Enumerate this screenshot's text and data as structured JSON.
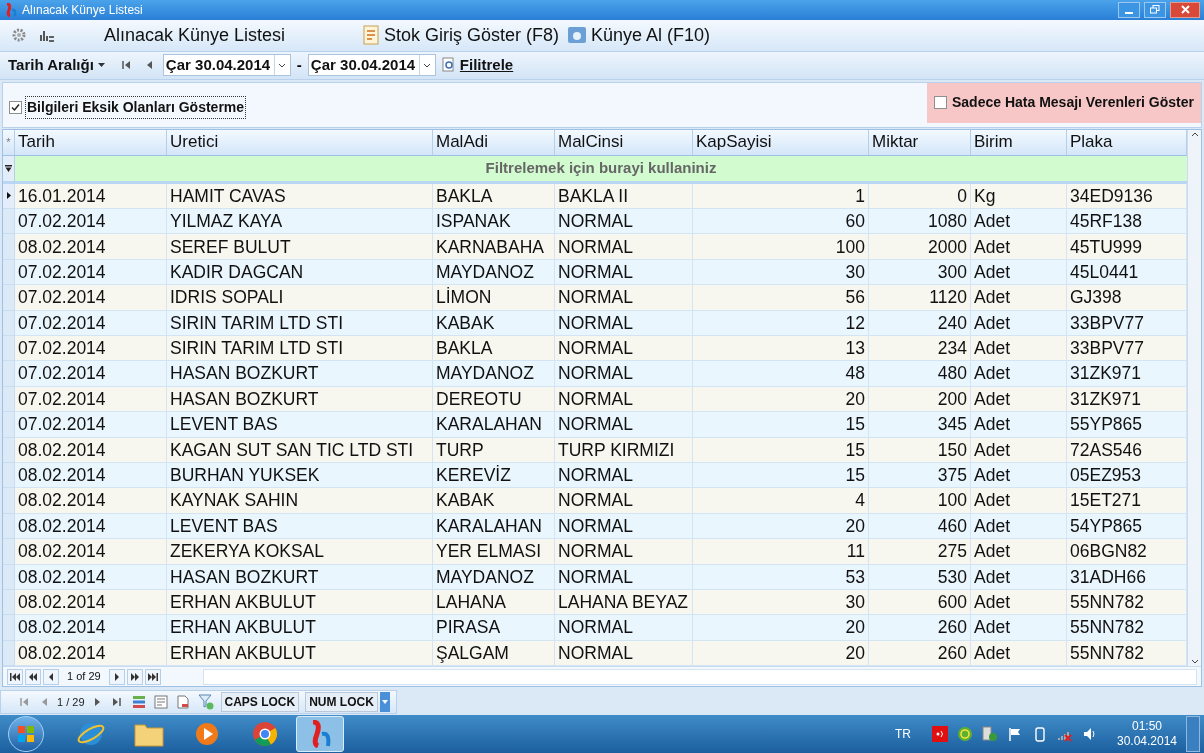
{
  "window": {
    "title": "Alınacak Künye Listesi"
  },
  "toolbar": {
    "title": "Alınacak Künye Listesi",
    "buttons": [
      "Stok Giriş Göster (F8)",
      "Künye Al (F10)"
    ]
  },
  "filter_bar": {
    "range_label": "Tarih Aralığı",
    "start_date": "Çar 30.04.2014",
    "separator": "-",
    "end_date": "Çar 30.04.2014",
    "filter_button": "Filitrele"
  },
  "options": [
    {
      "label": "Bilgileri Eksik Olanları Gösterme",
      "checked": true
    },
    {
      "label": "Sadece Hata Mesajı Verenleri Göster",
      "checked": false
    }
  ],
  "table": {
    "header_marker": "*",
    "columns": [
      "Tarih",
      "Uretici",
      "MalAdi",
      "MalCinsi",
      "KapSayisi",
      "Miktar",
      "Birim",
      "Plaka"
    ],
    "filter_hint": "Filtrelemek için burayi kullaniniz",
    "rows": [
      {
        "selected": true,
        "cells": [
          "16.01.2014",
          "HAMIT CAVAS",
          "BAKLA",
          "BAKLA II",
          "1",
          "0",
          "Kg",
          "34ED9136"
        ]
      },
      {
        "selected": false,
        "cells": [
          "07.02.2014",
          "YILMAZ KAYA",
          "ISPANAK",
          "NORMAL",
          "60",
          "1080",
          "Adet",
          "45RF138"
        ]
      },
      {
        "selected": false,
        "cells": [
          "08.02.2014",
          "SEREF BULUT",
          "KARNABAHA",
          "NORMAL",
          "100",
          "2000",
          "Adet",
          "45TU999"
        ]
      },
      {
        "selected": false,
        "cells": [
          "07.02.2014",
          "KADIR DAGCAN",
          "MAYDANOZ",
          "NORMAL",
          "30",
          "300",
          "Adet",
          "45L0441"
        ]
      },
      {
        "selected": false,
        "cells": [
          "07.02.2014",
          "IDRIS SOPALI",
          "LİMON",
          "NORMAL",
          "56",
          "1120",
          "Adet",
          "GJ398"
        ]
      },
      {
        "selected": false,
        "cells": [
          "07.02.2014",
          "SIRIN TARIM LTD STI",
          "KABAK",
          "NORMAL",
          "12",
          "240",
          "Adet",
          "33BPV77"
        ]
      },
      {
        "selected": false,
        "cells": [
          "07.02.2014",
          "SIRIN TARIM LTD STI",
          "BAKLA",
          "NORMAL",
          "13",
          "234",
          "Adet",
          "33BPV77"
        ]
      },
      {
        "selected": false,
        "cells": [
          "07.02.2014",
          "HASAN BOZKURT",
          "MAYDANOZ",
          "NORMAL",
          "48",
          "480",
          "Adet",
          "31ZK971"
        ]
      },
      {
        "selected": false,
        "cells": [
          "07.02.2014",
          "HASAN BOZKURT",
          "DEREOTU",
          "NORMAL",
          "20",
          "200",
          "Adet",
          "31ZK971"
        ]
      },
      {
        "selected": false,
        "cells": [
          "07.02.2014",
          "LEVENT BAS",
          "KARALAHAN",
          "NORMAL",
          "15",
          "345",
          "Adet",
          "55YP865"
        ]
      },
      {
        "selected": false,
        "cells": [
          "08.02.2014",
          "KAGAN SUT SAN TIC LTD STI",
          "TURP",
          "TURP KIRMIZI",
          "15",
          "150",
          "Adet",
          "72AS546"
        ]
      },
      {
        "selected": false,
        "cells": [
          "08.02.2014",
          "BURHAN YUKSEK",
          "KEREVİZ",
          "NORMAL",
          "15",
          "375",
          "Adet",
          "05EZ953"
        ]
      },
      {
        "selected": false,
        "cells": [
          "08.02.2014",
          "KAYNAK SAHIN",
          "KABAK",
          "NORMAL",
          "4",
          "100",
          "Adet",
          "15ET271"
        ]
      },
      {
        "selected": false,
        "cells": [
          "08.02.2014",
          "LEVENT BAS",
          "KARALAHAN",
          "NORMAL",
          "20",
          "460",
          "Adet",
          "54YP865"
        ]
      },
      {
        "selected": false,
        "cells": [
          "08.02.2014",
          "ZEKERYA KOKSAL",
          "YER ELMASI",
          "NORMAL",
          "11",
          "275",
          "Adet",
          "06BGN82"
        ]
      },
      {
        "selected": false,
        "cells": [
          "08.02.2014",
          "HASAN BOZKURT",
          "MAYDANOZ",
          "NORMAL",
          "53",
          "530",
          "Adet",
          "31ADH66"
        ]
      },
      {
        "selected": false,
        "cells": [
          "08.02.2014",
          "ERHAN AKBULUT",
          "LAHANA",
          "LAHANA BEYAZ",
          "30",
          "600",
          "Adet",
          "55NN782"
        ]
      },
      {
        "selected": false,
        "cells": [
          "08.02.2014",
          "ERHAN AKBULUT",
          "PIRASA",
          "NORMAL",
          "20",
          "260",
          "Adet",
          "55NN782"
        ]
      },
      {
        "selected": false,
        "cells": [
          "08.02.2014",
          "ERHAN AKBULUT",
          "ŞALGAM",
          "NORMAL",
          "20",
          "260",
          "Adet",
          "55NN782"
        ]
      }
    ],
    "pager": "1 of 29"
  },
  "status_bar": {
    "record": "1 / 29",
    "keys": [
      "CAPS LOCK",
      "NUM LOCK"
    ]
  },
  "taskbar": {
    "language": "TR",
    "time": "01:50",
    "date": "30.04.2014"
  }
}
